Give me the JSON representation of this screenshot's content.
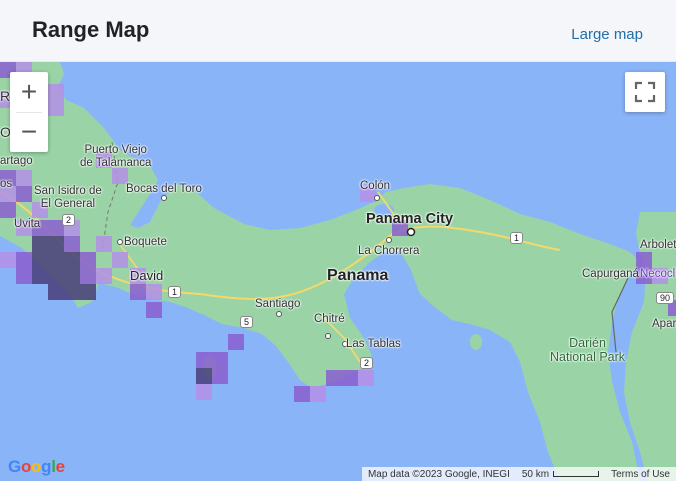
{
  "header": {
    "title": "Range Map",
    "large_map_link": "Large map"
  },
  "controls": {
    "zoom_in": "+",
    "zoom_out": "−"
  },
  "map_labels": {
    "panama_city": "Panama City",
    "panama": "Panama",
    "colon": "Colón",
    "la_chorrera": "La Chorrera",
    "santiago": "Santiago",
    "chitre": "Chitré",
    "las_tablas": "Las Tablas",
    "david": "David",
    "boquete": "Boquete",
    "bocas_del_toro": "Bocas del Toro",
    "puerto_viejo": "Puerto Viejo\nde Talamanca",
    "san_isidro": "San Isidro de\nEl General",
    "uvita": "Uvita",
    "cartago": "artago",
    "darien": "Darién\nNational Park",
    "capurgana": "Capurganá",
    "necocli": "Necocl",
    "arboletes": "Arbolet",
    "apartado": "Apar",
    "edge_r": "R",
    "edge_o": "O",
    "edge_s": "os"
  },
  "road_shields": {
    "r1a": "1",
    "r1b": "1",
    "r2a": "2",
    "r2b": "2",
    "r5": "5",
    "r90": "90"
  },
  "attribution": {
    "google": [
      "G",
      "o",
      "o",
      "g",
      "l",
      "e"
    ],
    "map_data": "Map data ©2023 Google, INEGI",
    "scale": "50 km",
    "terms": "Terms of Use"
  },
  "colors": {
    "water": "#8ab4f8",
    "land": "#9ad4a6",
    "range_light": "#b590e8",
    "range_mid": "#8a5fd0",
    "range_dark": "#4a3d7a"
  }
}
